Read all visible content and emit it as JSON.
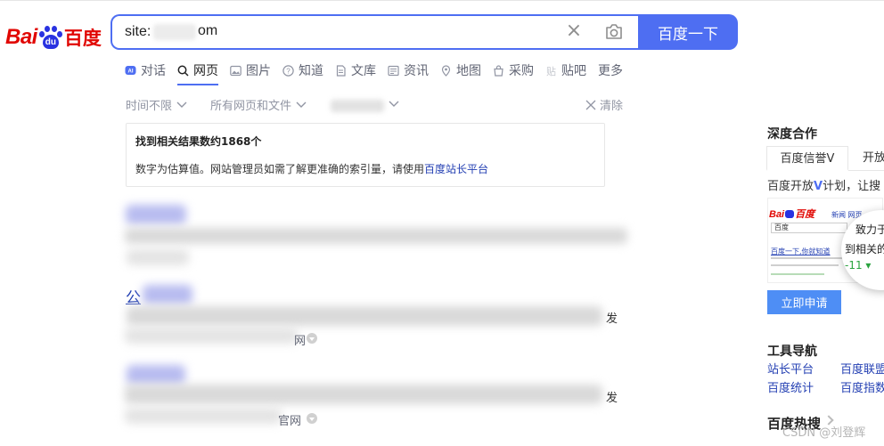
{
  "logo": {
    "latin": "Bai",
    "paw_text": "du",
    "cjk": "百度"
  },
  "search": {
    "query": "site:",
    "query_tail": "om",
    "button": "百度一下"
  },
  "tabs": [
    {
      "label": "对话",
      "icon": "ai-chat-icon"
    },
    {
      "label": "网页",
      "icon": "search-icon",
      "active": true
    },
    {
      "label": "图片",
      "icon": "image-icon"
    },
    {
      "label": "知道",
      "icon": "question-icon"
    },
    {
      "label": "文库",
      "icon": "document-icon"
    },
    {
      "label": "资讯",
      "icon": "news-icon"
    },
    {
      "label": "地图",
      "icon": "map-pin-icon"
    },
    {
      "label": "采购",
      "icon": "shopping-bag-icon"
    },
    {
      "label": "贴吧",
      "icon": "tieba-icon"
    },
    {
      "label": "更多",
      "icon": null
    }
  ],
  "filters": {
    "time": "时间不限",
    "type": "所有网页和文件",
    "clear": "清除"
  },
  "info": {
    "count_text": "找到相关结果数约1868个",
    "note_prefix": "数字为估算值。网站管理员如需了解更准确的索引量，请使用",
    "note_link": "百度站长平台"
  },
  "results": [
    {
      "title_prefix": "",
      "tail": "",
      "source_tail": ""
    },
    {
      "title_prefix": "公",
      "tail": "发",
      "source_tail": "网"
    },
    {
      "title_prefix": "",
      "tail": "发",
      "source_tail": "官网"
    }
  ],
  "sidebar": {
    "section1": "深度合作",
    "tab_active": "百度信誉V",
    "tab_other": "开放",
    "desc_prefix": "百度开放",
    "desc_v": "V",
    "desc_suffix": "计划，让搜",
    "preview": {
      "logo_bai": "Bai",
      "logo_cn": "百度",
      "links": "新闻  网页",
      "input": "百度",
      "result": "百度一下,你就知道"
    },
    "circle_line1": "致力于",
    "circle_line2": "到相关的",
    "circle_line3": "-11 ▾",
    "apply": "立即申请",
    "section2": "工具导航",
    "tools": [
      "站长平台",
      "百度联盟",
      "百度统计",
      "百度指数"
    ],
    "section3": "百度热搜"
  },
  "watermark": "CSDN @刘登辉",
  "colors": {
    "brand_blue": "#4e6ef2",
    "link": "#2440b3",
    "logo_red": "#e10602",
    "logo_blue": "#2932e1"
  }
}
